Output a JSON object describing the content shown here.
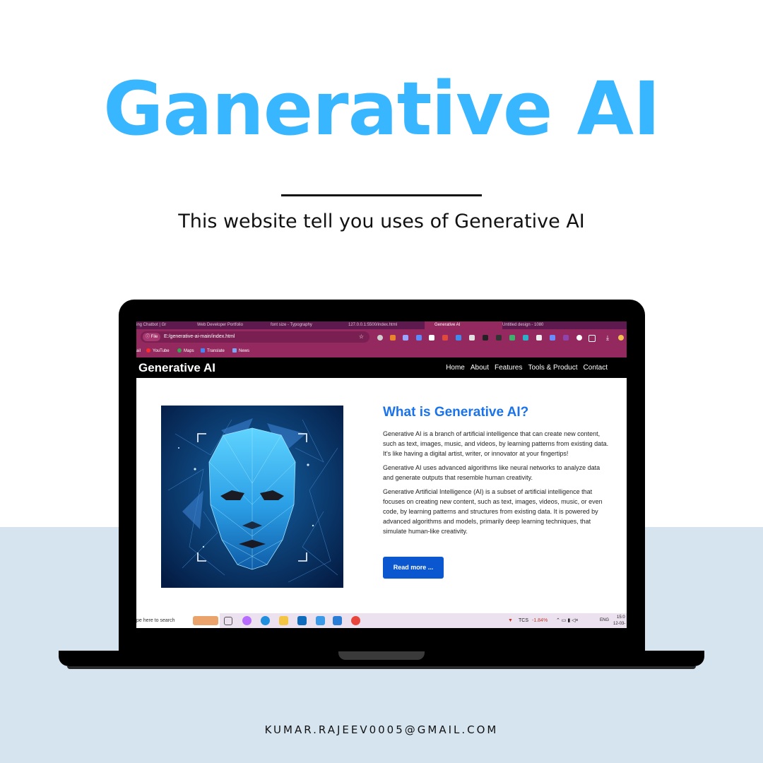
{
  "poster": {
    "title": "Ganerative AI",
    "subtitle": "This website tell you uses of Generative AI",
    "email": "KUMAR.RAJEEV0005@GMAIL.COM",
    "accent_color": "#38b6ff",
    "band_color": "#d6e4f0"
  },
  "browser": {
    "tabs": [
      {
        "label": "ing Chatbot | Gr",
        "active": false
      },
      {
        "label": "Web Developer Portfolio",
        "active": false
      },
      {
        "label": "font size - Typography",
        "active": false
      },
      {
        "label": "127.0.0.1:5500/index.html",
        "active": false
      },
      {
        "label": "Generative AI",
        "active": true
      },
      {
        "label": "Untitled design - 1080",
        "active": false
      }
    ],
    "address_chip": "File",
    "url": "E:/generative-ai-main/index.html",
    "bookmarks": [
      {
        "label": "ail",
        "icon": "gmail-icon"
      },
      {
        "label": "YouTube",
        "icon": "youtube-icon"
      },
      {
        "label": "Maps",
        "icon": "maps-icon"
      },
      {
        "label": "Translate",
        "icon": "translate-icon"
      },
      {
        "label": "News",
        "icon": "news-icon"
      }
    ]
  },
  "site": {
    "brand": "Generative AI",
    "nav": [
      "Home",
      "About",
      "Features",
      "Tools & Product",
      "Contact"
    ],
    "heading": "What is Generative AI?",
    "paragraphs": [
      "Generative AI is a branch of artificial intelligence that can create new content, such as text, images, music, and videos, by learning patterns from existing data. It's like having a digital artist, writer, or innovator at your fingertips!",
      "Generative AI uses advanced algorithms like neural networks to analyze data and generate outputs that resemble human creativity.",
      "Generative Artificial Intelligence (AI) is a subset of artificial intelligence that focuses on creating new content, such as text, images, videos, music, or even code, by learning patterns and structures from existing data. It is powered by advanced algorithms and models, primarily deep learning techniques, that simulate human-like creativity."
    ],
    "button": "Read more ...",
    "hero_image": "polygonal-ai-face-image"
  },
  "taskbar": {
    "search": "pe here to search",
    "stock_ticker": "TCS",
    "stock_change": "-1.84%",
    "language": "ENG",
    "time": "15:0",
    "date": "12-03-"
  }
}
